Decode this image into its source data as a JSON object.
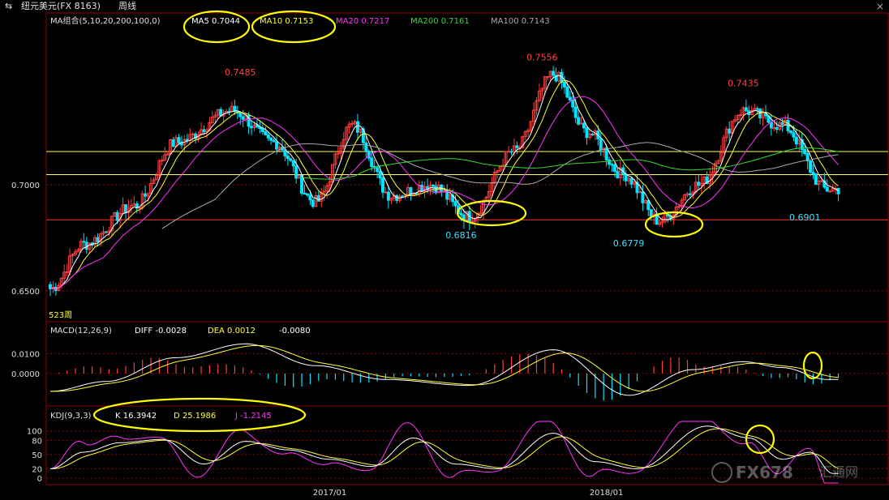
{
  "window": {
    "title": "纽元美元(FX 8163)",
    "period": "周线",
    "close": "×"
  },
  "colors": {
    "up": "#ff3b3b",
    "down": "#00e5ff",
    "ma5": "#ffffff",
    "ma10": "#ffff33",
    "ma20": "#ff33ff",
    "ma200": "#33dd33",
    "ma100": "#aaaaaa",
    "grid": "#8b0000",
    "annot": "#ffff00"
  },
  "legend": {
    "main_prefix": "MA组合(5,10,20,200,100,0)",
    "ma5": "MA5 0.7044",
    "ma10": "MA10 0.7153",
    "ma20": "MA20 0.7217",
    "ma200": "MA200 0.7161",
    "ma100": "MA100 0.7143",
    "macd_prefix": "MACD(12,26,9)",
    "macd_diff": "DIFF -0.0028",
    "macd_dea": "DEA 0.0012",
    "macd_val": "-0.0080",
    "kdj_prefix": "KDJ(9,3,3)",
    "kdj_k": "K 16.3942",
    "kdj_d": "D 25.1986",
    "kdj_j": "J -1.2145"
  },
  "chart_data": [
    {
      "type": "candlestick",
      "pane": "price",
      "ylim": [
        0.6362,
        0.7719
      ],
      "yticks": [
        "0.7000",
        "0.6500"
      ],
      "ytick_values": [
        0.7,
        0.65
      ],
      "xticks": [
        "2017/01",
        "2018/01"
      ],
      "xtick_index": [
        100,
        199
      ],
      "bar_count": 240,
      "anchors": [
        [
          0,
          0.651
        ],
        [
          12,
          0.672
        ],
        [
          30,
          0.69
        ],
        [
          45,
          0.72
        ],
        [
          65,
          0.735
        ],
        [
          80,
          0.72
        ],
        [
          95,
          0.692
        ],
        [
          108,
          0.728
        ],
        [
          122,
          0.695
        ],
        [
          136,
          0.7
        ],
        [
          150,
          0.685
        ],
        [
          166,
          0.716
        ],
        [
          180,
          0.752
        ],
        [
          192,
          0.725
        ],
        [
          205,
          0.705
        ],
        [
          218,
          0.683
        ],
        [
          232,
          0.7
        ],
        [
          248,
          0.735
        ],
        [
          262,
          0.728
        ],
        [
          278,
          0.698
        ]
      ],
      "price_labels": [
        {
          "text": "0.7485",
          "value": 0.7485,
          "bar": 68
        },
        {
          "text": "0.7556",
          "value": 0.7556,
          "bar": 176
        },
        {
          "text": "0.7435",
          "value": 0.7435,
          "bar": 248
        },
        {
          "text": "0.6816",
          "value": 0.6816,
          "bar": 147
        },
        {
          "text": "0.6779",
          "value": 0.6779,
          "bar": 207
        },
        {
          "text": "0.6901",
          "value": 0.6901,
          "bar": 270
        }
      ],
      "horizontal_lines": [
        0.7157,
        0.7048,
        0.6835
      ],
      "bottom_note": "523周"
    },
    {
      "type": "bar+line",
      "pane": "MACD",
      "ylim": [
        -0.016,
        0.018
      ],
      "yticks": [
        "0.0100",
        "0.0000"
      ],
      "ytick_values": [
        0.01,
        0.0
      ],
      "anchors": [
        [
          0,
          -0.009
        ],
        [
          20,
          -0.004
        ],
        [
          45,
          0.008
        ],
        [
          70,
          0.015
        ],
        [
          95,
          0.004
        ],
        [
          120,
          -0.003
        ],
        [
          150,
          -0.006
        ],
        [
          180,
          0.012
        ],
        [
          207,
          -0.011
        ],
        [
          230,
          0.002
        ],
        [
          248,
          0.006
        ],
        [
          262,
          0.003
        ],
        [
          278,
          -0.003
        ]
      ]
    },
    {
      "type": "line",
      "pane": "KDJ",
      "ylim": [
        -10,
        120
      ],
      "yticks": [
        "100",
        "80",
        "50",
        "20",
        "0"
      ],
      "ytick_values": [
        100,
        80,
        50,
        20,
        0
      ],
      "anchors": [
        [
          0,
          20
        ],
        [
          12,
          55
        ],
        [
          25,
          75
        ],
        [
          40,
          82
        ],
        [
          55,
          30
        ],
        [
          70,
          78
        ],
        [
          85,
          60
        ],
        [
          100,
          40
        ],
        [
          115,
          25
        ],
        [
          130,
          85
        ],
        [
          145,
          30
        ],
        [
          160,
          20
        ],
        [
          180,
          95
        ],
        [
          195,
          35
        ],
        [
          210,
          20
        ],
        [
          235,
          110
        ],
        [
          250,
          85
        ],
        [
          262,
          40
        ],
        [
          272,
          55
        ],
        [
          280,
          10
        ]
      ]
    }
  ],
  "x_axis": {
    "labels": [
      "2017/01",
      "2018/01"
    ]
  },
  "watermark": {
    "text": "FX678",
    "sub": "汇通网"
  }
}
